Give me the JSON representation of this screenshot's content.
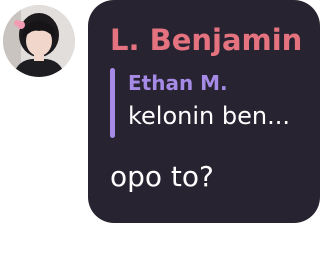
{
  "message": {
    "sender_name": "L. Benjamin",
    "sender_color": "#e5737f",
    "bubble_color": "#282331",
    "reply": {
      "author": "Ethan M.",
      "text": "kelonin ben...",
      "accent_color": "#a58ae6"
    },
    "text": "opo to?"
  },
  "avatar": {
    "icon": "user-avatar-photo"
  }
}
